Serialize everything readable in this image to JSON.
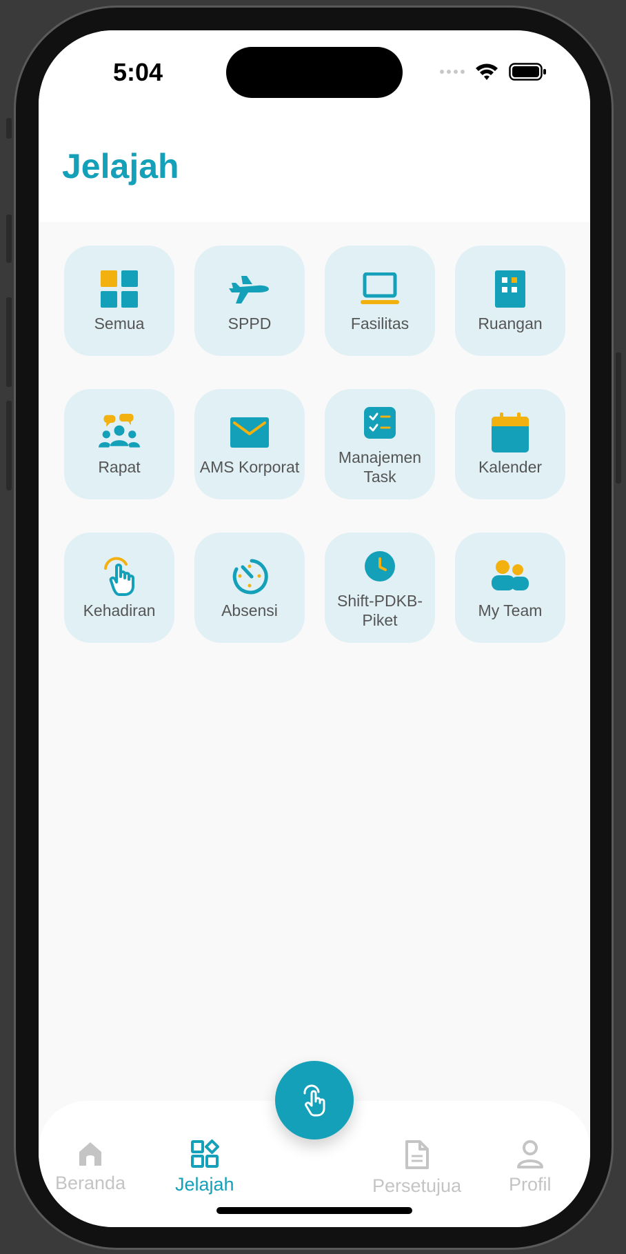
{
  "status": {
    "time": "5:04"
  },
  "header": {
    "title": "Jelajah"
  },
  "menu": [
    {
      "label": "Semua",
      "icon": "grid-icon"
    },
    {
      "label": "SPPD",
      "icon": "airplane-icon"
    },
    {
      "label": "Fasilitas",
      "icon": "laptop-icon"
    },
    {
      "label": "Ruangan",
      "icon": "building-icon"
    },
    {
      "label": "Rapat",
      "icon": "meeting-icon"
    },
    {
      "label": "AMS Korporat",
      "icon": "mail-icon"
    },
    {
      "label": "Manajemen Task",
      "icon": "task-icon"
    },
    {
      "label": "Kalender",
      "icon": "calendar-icon"
    },
    {
      "label": "Kehadiran",
      "icon": "touch-icon"
    },
    {
      "label": "Absensi",
      "icon": "timer-icon"
    },
    {
      "label": "Shift-PDKB-Piket",
      "icon": "clock-icon"
    },
    {
      "label": "My Team",
      "icon": "team-icon"
    }
  ],
  "nav": {
    "home": "Beranda",
    "explore": "Jelajah",
    "approval": "Persetujua",
    "profile": "Profil"
  },
  "colors": {
    "primary": "#14a0b8",
    "accent": "#f2b10f",
    "tile": "#e0f0f4"
  }
}
